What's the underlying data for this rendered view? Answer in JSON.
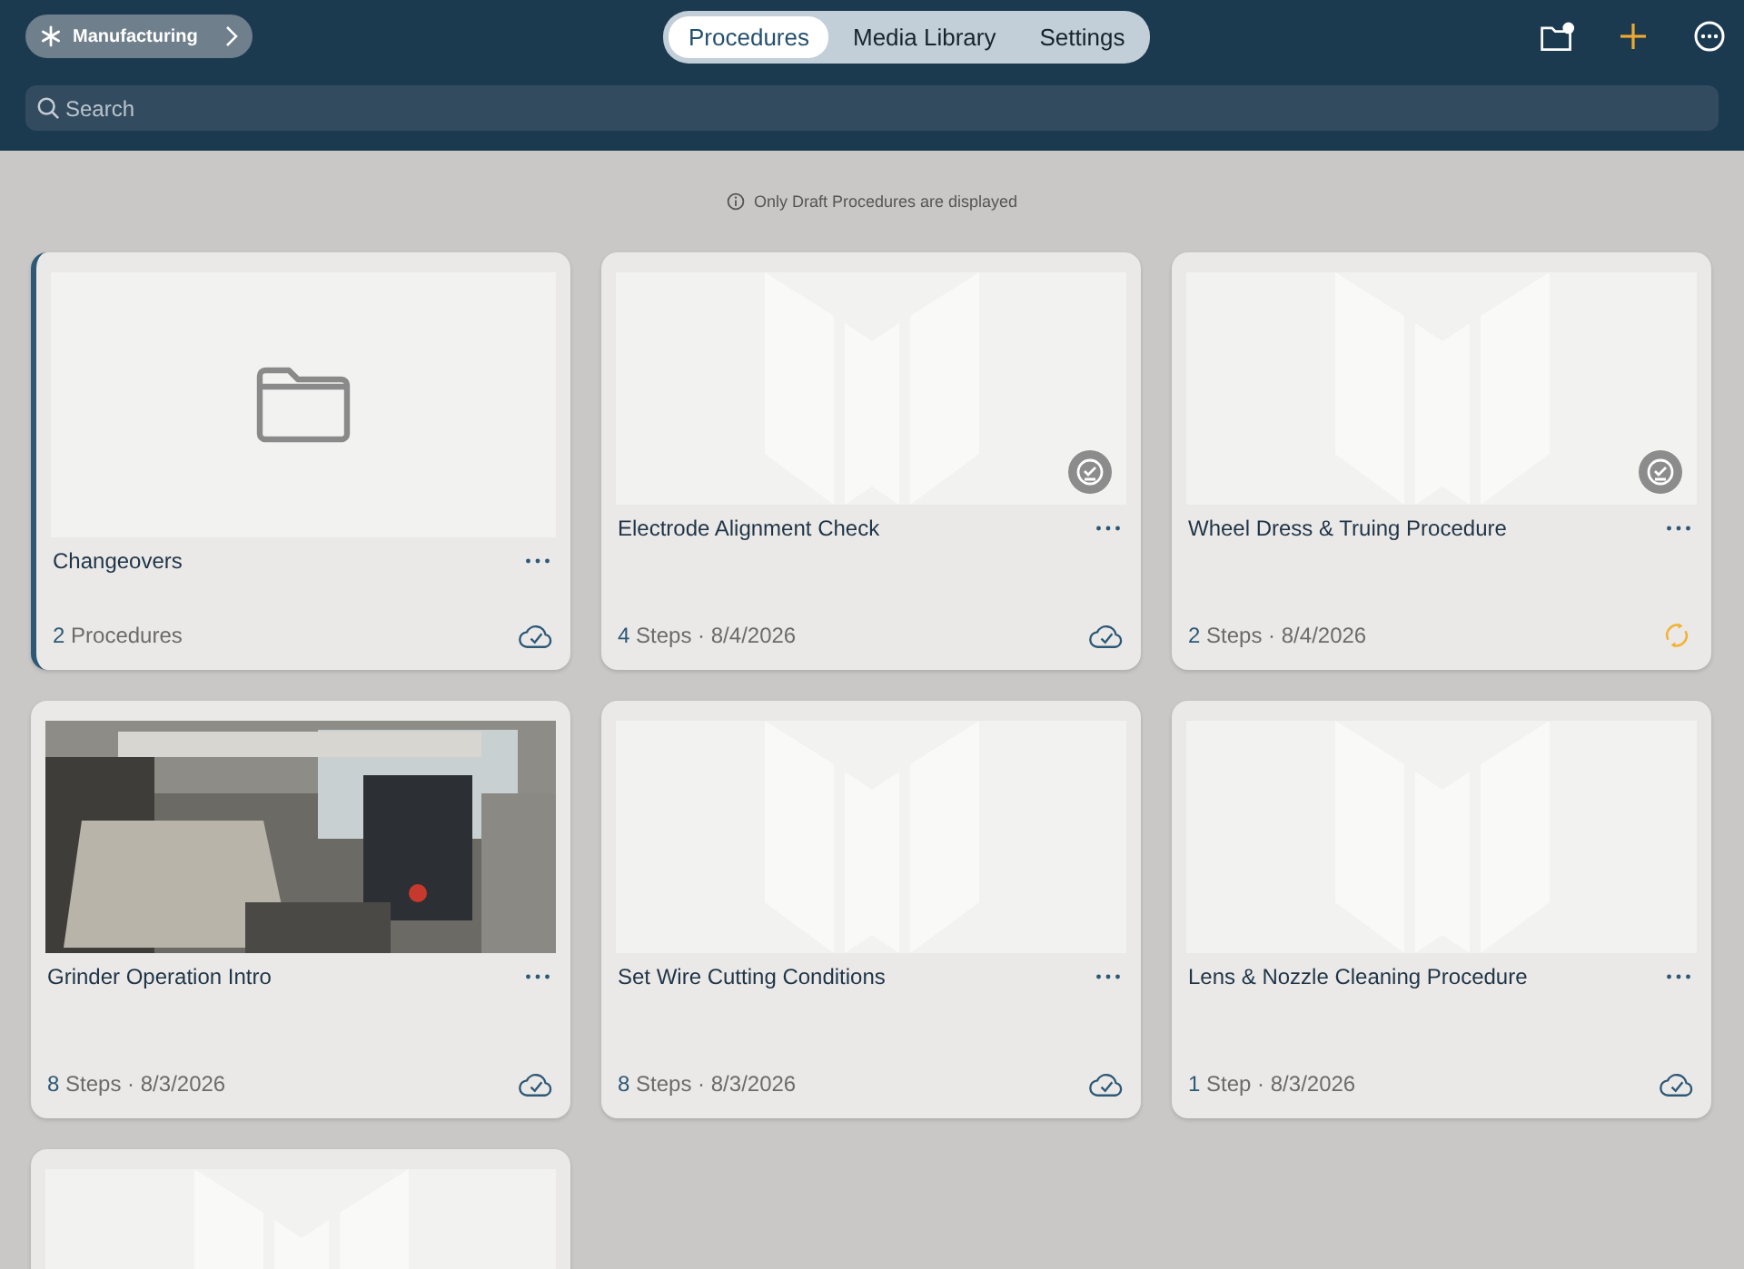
{
  "header": {
    "workspace": {
      "label": "Manufacturing"
    },
    "tabs": [
      {
        "label": "Procedures",
        "selected": true
      },
      {
        "label": "Media Library",
        "selected": false
      },
      {
        "label": "Settings",
        "selected": false
      }
    ]
  },
  "search": {
    "placeholder": "Search"
  },
  "notice": "Only Draft Procedures are displayed",
  "cards": [
    {
      "kind": "folder",
      "thumbnail": {
        "kind": "folder"
      },
      "title": "Changeovers",
      "count": "2",
      "meta": "Procedures",
      "syncing": false,
      "reviewed": false
    },
    {
      "kind": "procedure",
      "thumbnail": {
        "kind": "placeholder"
      },
      "title": "Electrode Alignment Check",
      "count": "4",
      "meta": "Steps · 8/4/2026",
      "syncing": false,
      "reviewed": true
    },
    {
      "kind": "procedure",
      "thumbnail": {
        "kind": "placeholder"
      },
      "title": "Wheel Dress & Truing Procedure",
      "count": "2",
      "meta": "Steps · 8/4/2026",
      "syncing": true,
      "reviewed": true
    },
    {
      "kind": "procedure",
      "title": "Grinder Operation Intro",
      "count": "8",
      "meta": "Steps · 8/3/2026",
      "syncing": false,
      "reviewed": false
    },
    {
      "kind": "procedure",
      "thumbnail": {
        "kind": "placeholder"
      },
      "title": "Set Wire Cutting Conditions",
      "count": "8",
      "meta": "Steps · 8/3/2026",
      "syncing": false,
      "reviewed": false
    },
    {
      "kind": "procedure",
      "thumbnail": {
        "kind": "placeholder"
      },
      "title": "Lens & Nozzle Cleaning Procedure",
      "count": "1",
      "meta": "Step · 8/3/2026",
      "syncing": false,
      "reviewed": false
    },
    {
      "kind": "procedure",
      "thumbnail": {
        "kind": "placeholder"
      },
      "reviewed": false
    }
  ]
}
